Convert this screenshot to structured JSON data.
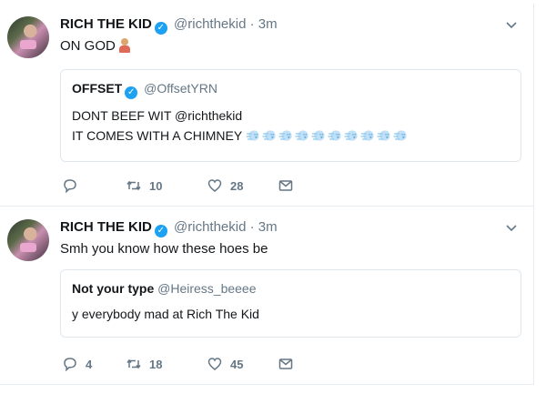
{
  "tweets": [
    {
      "author_name": "RICH THE KID",
      "verified_mark": "✓",
      "handle": "@richthekid",
      "separator": "·",
      "time": "3m",
      "text": "ON GOD",
      "quoted": {
        "author_name": "OFFSET",
        "verified": true,
        "handle": "@OffsetYRN",
        "lines": [
          "DONT BEEF WIT @richthekid",
          "IT COMES WITH A CHIMNEY"
        ],
        "emoji_icon": "wind-face-icon",
        "emoji_count": 10
      },
      "actions": {
        "reply": "",
        "retweet": "10",
        "like": "28"
      }
    },
    {
      "author_name": "RICH THE KID",
      "verified_mark": "✓",
      "handle": "@richthekid",
      "separator": "·",
      "time": "3m",
      "text": "Smh you know how these hoes be",
      "quoted": {
        "author_name": "Not your type",
        "verified": false,
        "handle": "@Heiress_beeee",
        "lines": [
          "y everybody mad at Rich The Kid"
        ]
      },
      "actions": {
        "reply": "4",
        "retweet": "18",
        "like": "45"
      }
    }
  ],
  "colors": {
    "verified": "#1da1f2",
    "muted": "#657786",
    "border": "#e1e8ed"
  },
  "icons": {
    "reply": "reply-icon",
    "retweet": "retweet-icon",
    "like": "heart-icon",
    "dm": "envelope-icon",
    "menu": "chevron-down-icon"
  }
}
